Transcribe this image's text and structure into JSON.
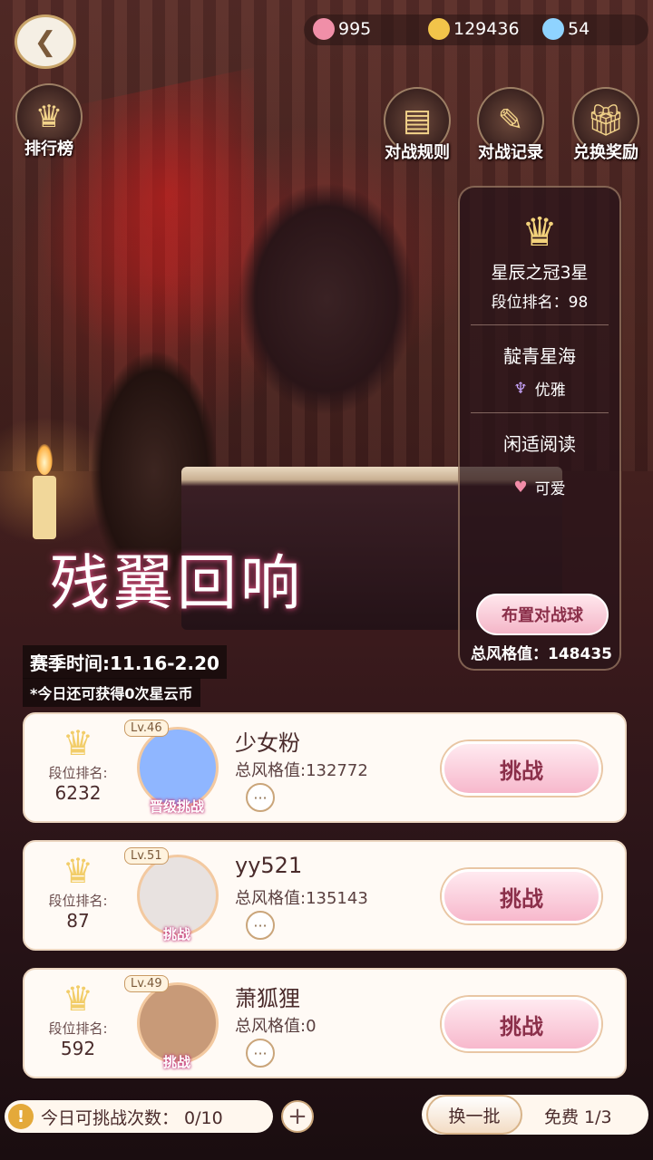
{
  "resources": {
    "gems": "995",
    "coins": "129436",
    "crystals": "54"
  },
  "top_buttons": {
    "leaderboard": "排行榜",
    "battle_rules": "对战规则",
    "battle_records": "对战记录",
    "redeem_rewards": "兑换奖励"
  },
  "side_panel": {
    "tier": "星辰之冠3星",
    "rank_line": "段位排名：98",
    "trait_1": "靛青星海",
    "trait_1_sub": "优雅",
    "trait_2": "闲适阅读",
    "trait_2_sub": "可爱",
    "arrange_button": "布置对战球",
    "total_style": "总风格值：148435"
  },
  "event_title": "残翼回响",
  "season_time": "赛季时间:11.16-2.20",
  "daily_tip": "*今日还可获得0次星云币",
  "opponents": [
    {
      "rank_label": "段位排名:",
      "rank": "6232",
      "level": "Lv.46",
      "avatar_tag": "晋级挑战",
      "name": "少女粉",
      "score": "总风格值:132772",
      "button": "挑战",
      "avatar_color": "#8fb6ff"
    },
    {
      "rank_label": "段位排名:",
      "rank": "87",
      "level": "Lv.51",
      "avatar_tag": "挑战",
      "name": "yy521",
      "score": "总风格值:135143",
      "button": "挑战",
      "avatar_color": "#e8e2e0"
    },
    {
      "rank_label": "段位排名:",
      "rank": "592",
      "level": "Lv.49",
      "avatar_tag": "挑战",
      "name": "萧狐狸",
      "score": "总风格值:0",
      "button": "挑战",
      "avatar_color": "#c89a78"
    }
  ],
  "footer": {
    "attempts": "今日可挑战次数： 0/10",
    "refresh_button": "换一批",
    "free": "免费  1/3"
  },
  "colors": {
    "gem": "#f08fa8",
    "coin": "#f2c44a",
    "crystal": "#8fd3ff",
    "accent_pink": "#f7b8cc"
  }
}
